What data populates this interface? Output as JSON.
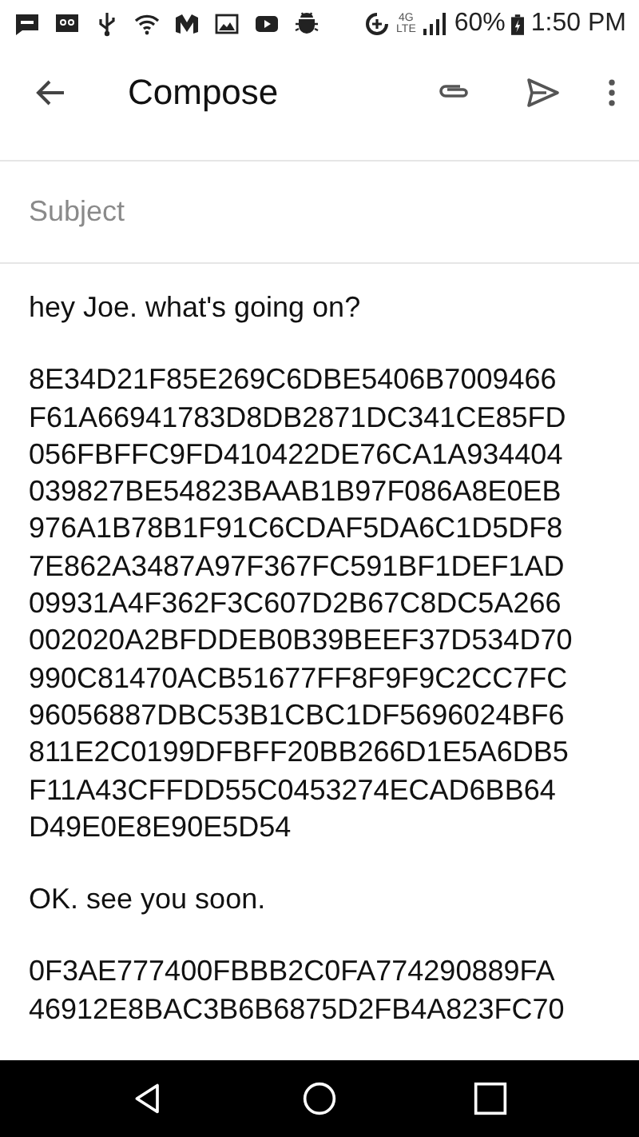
{
  "status_bar": {
    "network": "4G",
    "network_sub": "LTE",
    "battery": "60%",
    "time": "1:50 PM"
  },
  "toolbar": {
    "title": "Compose"
  },
  "subject": {
    "placeholder": "Subject"
  },
  "body": [
    {
      "lines": [
        "hey Joe. what's going on?"
      ]
    },
    {
      "lines": [
        "8E34D21F85E269C6DBE5406B7009466",
        "F61A66941783D8DB2871DC341CE85FD",
        "056FBFFC9FD410422DE76CA1A934404",
        "039827BE54823BAAB1B97F086A8E0EB",
        "976A1B78B1F91C6CDAF5DA6C1D5DF8",
        "7E862A3487A97F367FC591BF1DEF1AD",
        "09931A4F362F3C607D2B67C8DC5A266",
        "002020A2BFDDEB0B39BEEF37D534D70",
        "990C81470ACB51677FF8F9F9C2CC7FC",
        "96056887DBC53B1CBC1DF5696024BF6",
        "811E2C0199DFBFF20BB266D1E5A6DB5",
        "F11A43CFFDD55C0453274ECAD6BB64",
        "D49E0E8E90E5D54"
      ]
    },
    {
      "lines": [
        "OK. see you soon."
      ]
    },
    {
      "lines": [
        "0F3AE777400FBBB2C0FA774290889FA",
        "46912E8BAC3B6B6875D2FB4A823FC70"
      ]
    }
  ]
}
